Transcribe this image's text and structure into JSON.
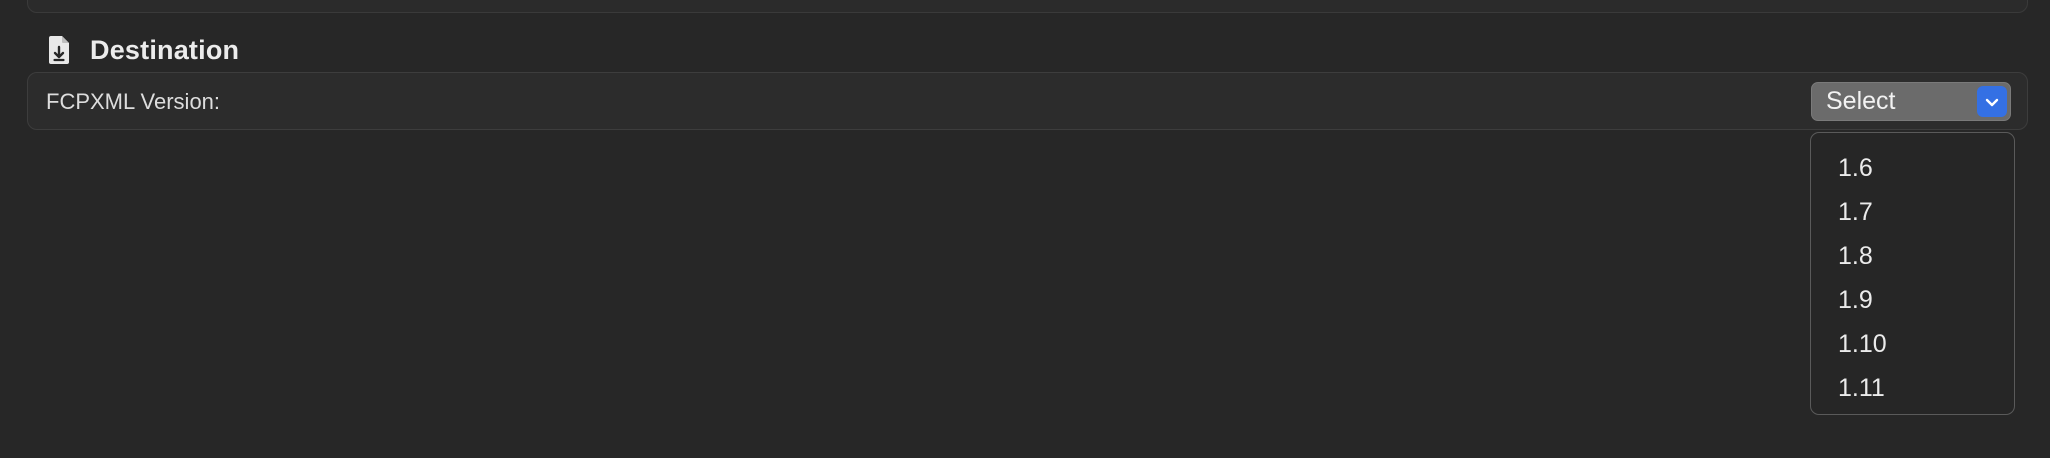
{
  "destination": {
    "title": "Destination",
    "icon": "document-download-icon",
    "fcpxml_version": {
      "label": "FCPXML Version:",
      "select_value": "Select",
      "options": [
        "1.6",
        "1.7",
        "1.8",
        "1.9",
        "1.10",
        "1.11"
      ]
    }
  },
  "colors": {
    "background": "#272727",
    "panel": "#2c2c2c",
    "accent": "#3470e4",
    "select_bg": "#6b6b6b"
  }
}
